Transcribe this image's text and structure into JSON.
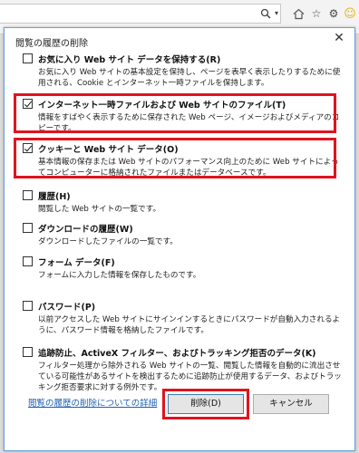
{
  "browser": {
    "search_icon": "search-icon",
    "dropdown_icon": "chevron-down-icon",
    "icons": [
      "home-icon",
      "star-icon",
      "gear-icon",
      "smiley-icon"
    ]
  },
  "dialog": {
    "title": "閲覧の履歴の削除",
    "close_label": "✕",
    "options": [
      {
        "label": "お気に入り Web サイト データを保持する(R)",
        "checked": false,
        "description": "お気に入り Web サイトの基本設定を保持し、ページを表早く表示したりするために使用される、Cookie とインターネット一時ファイルを保持します。"
      },
      {
        "label": "インターネット一時ファイルおよび Web サイトのファイル(T)",
        "checked": true,
        "description": "情報をすばやく表示するために保存された Web ページ、イメージおよびメディアのコピーです。"
      },
      {
        "label": "クッキーと Web サイト データ(O)",
        "checked": true,
        "description": "基本情報の保存または Web サイトのパフォーマンス向上のために Web サイトによってコンピューターに格納されたファイルまたはデータベースです。"
      },
      {
        "label": "履歴(H)",
        "checked": false,
        "description": "閲覧した Web サイトの一覧です。"
      },
      {
        "label": "ダウンロードの履歴(W)",
        "checked": false,
        "description": "ダウンロードしたファイルの一覧です。"
      },
      {
        "label": "フォーム データ(F)",
        "checked": false,
        "description": "フォームに入力した情報を保存したものです。"
      },
      {
        "label": "パスワード(P)",
        "checked": false,
        "description": "以前アクセスした Web サイトにサインインするときにパスワードが自動入力されるように、パスワード情報を格納したファイルです。"
      },
      {
        "label": "追跡防止、ActiveX フィルター、およびトラッキング拒否のデータ(K)",
        "checked": false,
        "description": "フィルター処理から除外される Web サイトの一覧、閲覧した情報を自動的に流出させている可能性があるサイトを検出するために追跡防止が使用するデータ、およびトラッキング拒否要求に対する例外です。"
      }
    ],
    "details_link": "閲覧の履歴の削除についての詳細",
    "delete_button": "削除(D)",
    "cancel_button": "キャンセル"
  },
  "accent_colors": {
    "highlight_red": "#e0141e",
    "link_blue": "#1d5fb3"
  }
}
